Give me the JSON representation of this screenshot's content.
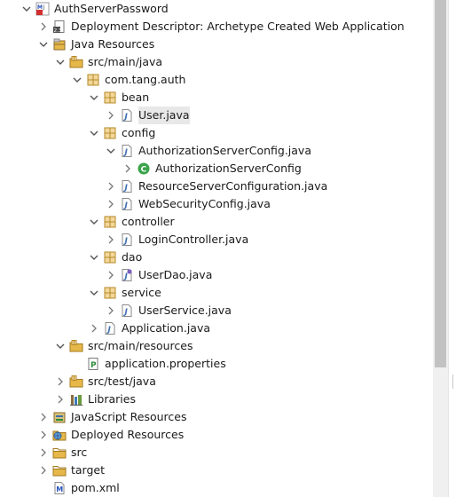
{
  "tree": [
    {
      "label": "AuthServerPassword",
      "depth": 0,
      "toggle": "open",
      "icon": "maven-project-icon"
    },
    {
      "label": "Deployment Descriptor: Archetype Created Web Application",
      "depth": 1,
      "toggle": "closed",
      "icon": "deployment-descriptor-icon"
    },
    {
      "label": "Java Resources",
      "depth": 1,
      "toggle": "open",
      "icon": "java-resources-icon"
    },
    {
      "label": "src/main/java",
      "depth": 2,
      "toggle": "open",
      "icon": "source-folder-icon"
    },
    {
      "label": "com.tang.auth",
      "depth": 3,
      "toggle": "open",
      "icon": "package-icon"
    },
    {
      "label": "bean",
      "depth": 4,
      "toggle": "open",
      "icon": "package-icon"
    },
    {
      "label": "User.java",
      "depth": 5,
      "toggle": "closed",
      "icon": "java-file-icon",
      "selected": true
    },
    {
      "label": "config",
      "depth": 4,
      "toggle": "open",
      "icon": "package-icon"
    },
    {
      "label": "AuthorizationServerConfig.java",
      "depth": 5,
      "toggle": "open",
      "icon": "java-file-icon"
    },
    {
      "label": "AuthorizationServerConfig",
      "depth": 6,
      "toggle": "closed",
      "icon": "class-icon"
    },
    {
      "label": "ResourceServerConfiguration.java",
      "depth": 5,
      "toggle": "closed",
      "icon": "java-file-icon"
    },
    {
      "label": "WebSecurityConfig.java",
      "depth": 5,
      "toggle": "closed",
      "icon": "java-file-icon"
    },
    {
      "label": "controller",
      "depth": 4,
      "toggle": "open",
      "icon": "package-icon"
    },
    {
      "label": "LoginController.java",
      "depth": 5,
      "toggle": "closed",
      "icon": "java-file-icon"
    },
    {
      "label": "dao",
      "depth": 4,
      "toggle": "open",
      "icon": "package-icon"
    },
    {
      "label": "UserDao.java",
      "depth": 5,
      "toggle": "closed",
      "icon": "interface-file-icon"
    },
    {
      "label": "service",
      "depth": 4,
      "toggle": "open",
      "icon": "package-icon"
    },
    {
      "label": "UserService.java",
      "depth": 5,
      "toggle": "closed",
      "icon": "java-file-icon"
    },
    {
      "label": "Application.java",
      "depth": 4,
      "toggle": "closed",
      "icon": "java-file-icon"
    },
    {
      "label": "src/main/resources",
      "depth": 2,
      "toggle": "open",
      "icon": "source-folder-icon"
    },
    {
      "label": "application.properties",
      "depth": 3,
      "toggle": "none",
      "icon": "properties-file-icon"
    },
    {
      "label": "src/test/java",
      "depth": 2,
      "toggle": "closed",
      "icon": "source-folder-icon"
    },
    {
      "label": "Libraries",
      "depth": 2,
      "toggle": "closed",
      "icon": "libraries-icon"
    },
    {
      "label": "JavaScript Resources",
      "depth": 1,
      "toggle": "closed",
      "icon": "javascript-resources-icon"
    },
    {
      "label": "Deployed Resources",
      "depth": 1,
      "toggle": "closed",
      "icon": "deployed-resources-icon"
    },
    {
      "label": "src",
      "depth": 1,
      "toggle": "closed",
      "icon": "folder-icon"
    },
    {
      "label": "target",
      "depth": 1,
      "toggle": "closed",
      "icon": "folder-icon"
    },
    {
      "label": "pom.xml",
      "depth": 1,
      "toggle": "none",
      "icon": "maven-pom-icon"
    }
  ],
  "colors": {
    "package": "#b58a2a",
    "java": "#3f6fb0",
    "class": "#39a34a",
    "folder": "#e6b84a",
    "selection": "#e8e8e8",
    "scrollbar_thumb": "#c2c2c2"
  },
  "scroll": {
    "visible_fraction": 0.74
  }
}
